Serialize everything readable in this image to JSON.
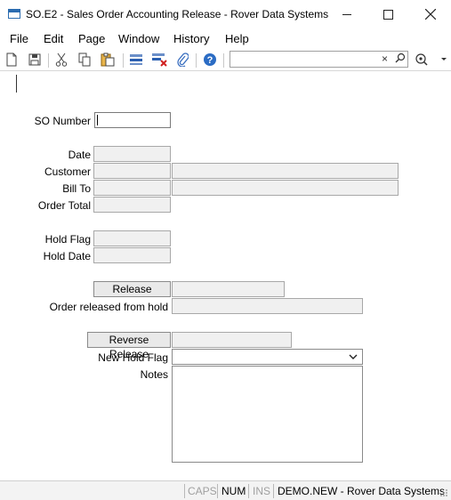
{
  "window": {
    "title": "SO.E2 - Sales Order Accounting Release - Rover Data Systems",
    "minimize_icon": "minimize-icon",
    "maximize_icon": "maximize-icon",
    "close_icon": "close-icon"
  },
  "menu": {
    "items": [
      {
        "label": "File"
      },
      {
        "label": "Edit"
      },
      {
        "label": "Page"
      },
      {
        "label": "Window"
      },
      {
        "label": "History"
      },
      {
        "label": "Help"
      }
    ]
  },
  "toolbar": {
    "icons": [
      "new-document-icon",
      "save-icon",
      "cut-icon",
      "copy-icon",
      "paste-icon",
      "insert-row-icon",
      "delete-row-icon",
      "attach-icon",
      "help-icon"
    ],
    "search": {
      "value": "",
      "placeholder": ""
    },
    "search_clear_glyph": "×"
  },
  "form": {
    "so_number": {
      "label": "SO Number",
      "value": ""
    },
    "date": {
      "label": "Date",
      "value": ""
    },
    "customer": {
      "label": "Customer",
      "value": "",
      "name": ""
    },
    "bill_to": {
      "label": "Bill To",
      "value": "",
      "name": ""
    },
    "order_total": {
      "label": "Order Total",
      "value": ""
    },
    "hold_flag": {
      "label": "Hold Flag",
      "value": ""
    },
    "hold_date": {
      "label": "Hold Date",
      "value": ""
    },
    "release": {
      "button_label": "Release",
      "value": ""
    },
    "order_released": {
      "label": "Order released from hold",
      "value": ""
    },
    "reverse_release": {
      "button_label": "Reverse Release",
      "value": ""
    },
    "new_hold_flag": {
      "label": "New Hold Flag",
      "value": ""
    },
    "notes": {
      "label": "Notes",
      "value": ""
    }
  },
  "status": {
    "caps": "CAPS",
    "num": "NUM",
    "ins": "INS",
    "system": "DEMO.NEW - Rover Data Systems",
    "colors": {
      "inactive": "#a0a0a0",
      "active": "#000000"
    }
  }
}
